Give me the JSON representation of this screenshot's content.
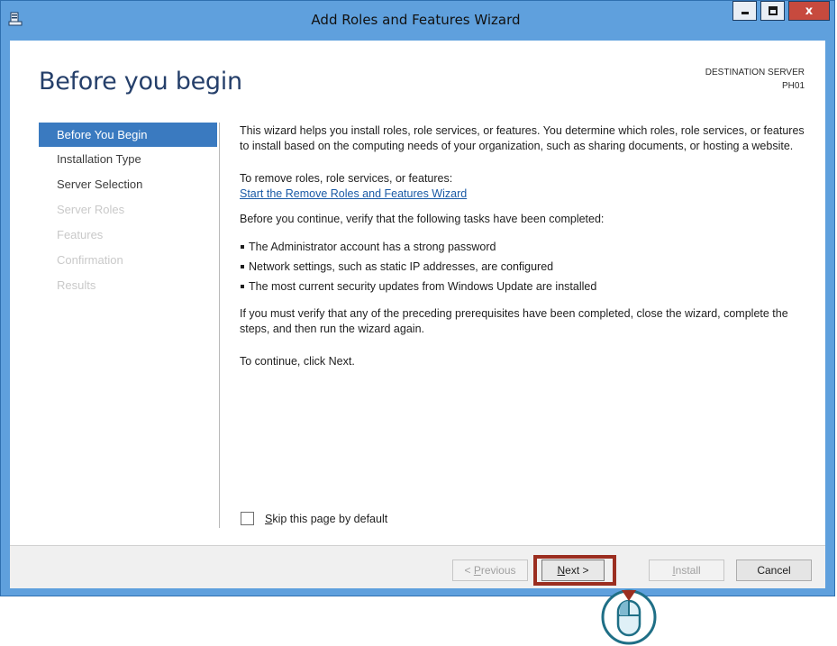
{
  "window": {
    "title": "Add Roles and Features Wizard",
    "icon": "server-manager-icon",
    "controls": {
      "minimize": "minimize-icon",
      "maximize": "maximize-icon",
      "close_label": "x"
    }
  },
  "header": {
    "page_title": "Before you begin",
    "destination_label": "DESTINATION SERVER",
    "destination_server": "PH01"
  },
  "nav": {
    "items": [
      {
        "label": "Before You Begin",
        "state": "active"
      },
      {
        "label": "Installation Type",
        "state": "enabled"
      },
      {
        "label": "Server Selection",
        "state": "enabled"
      },
      {
        "label": "Server Roles",
        "state": "disabled"
      },
      {
        "label": "Features",
        "state": "disabled"
      },
      {
        "label": "Confirmation",
        "state": "disabled"
      },
      {
        "label": "Results",
        "state": "disabled"
      }
    ]
  },
  "content": {
    "intro": "This wizard helps you install roles, role services, or features. You determine which roles, role services, or features to install based on the computing needs of your organization, such as sharing documents, or hosting a website.",
    "remove_heading": "To remove roles, role services, or features:",
    "remove_link": "Start the Remove Roles and Features Wizard",
    "verify_text": "Before you continue, verify that the following tasks have been completed:",
    "tasks": [
      "The Administrator account has a strong password",
      "Network settings, such as static IP addresses, are configured",
      "The most current security updates from Windows Update are installed"
    ],
    "prereq_text": "If you must verify that any of the preceding prerequisites have been completed, close the wizard, complete the steps, and then run the wizard again.",
    "continue_text": "To continue, click Next."
  },
  "skip": {
    "label_underlined": "S",
    "label_rest": "kip this page by default",
    "checked": false
  },
  "footer": {
    "previous_prefix": "< ",
    "previous_u": "P",
    "previous_rest": "revious",
    "next_u": "N",
    "next_rest": "ext >",
    "install_u": "I",
    "install_rest": "nstall",
    "cancel_label": "Cancel"
  },
  "overlay": {
    "pointer": "mouse-click-icon"
  },
  "colors": {
    "window_frame": "#5fa0dd",
    "nav_active": "#3a7ac0",
    "title_text": "#253f6a",
    "link": "#1a5aa6",
    "highlight": "#9b2e20",
    "close_button": "#c74a3e"
  }
}
